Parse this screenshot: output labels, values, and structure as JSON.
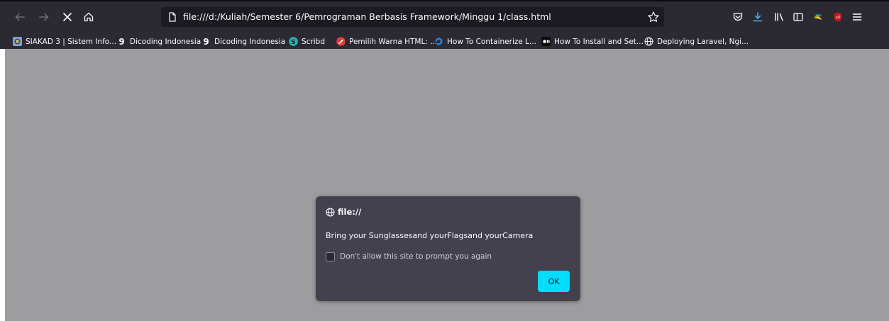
{
  "browser": {
    "url": "file:///d:/Kuliah/Semester 6/Pemrograman Berbasis Framework/Minggu 1/class.html"
  },
  "bookmarks": [
    {
      "label": "SIAKAD 3 | Sistem Info...",
      "icon": "siakad-icon"
    },
    {
      "label": "Dicoding Indonesia",
      "icon": "dicoding-icon"
    },
    {
      "label": "Dicoding Indonesia",
      "icon": "dicoding-icon"
    },
    {
      "label": "Scribd",
      "icon": "scribd-icon"
    },
    {
      "label": "Pemilih Warna HTML: ...",
      "icon": "color-picker-icon"
    },
    {
      "label": "How To Containerize L...",
      "icon": "digitalocean-icon"
    },
    {
      "label": "How To Install and Set...",
      "icon": "medium-icon"
    },
    {
      "label": "Deploying Laravel, Ngi...",
      "icon": "globe-icon"
    }
  ],
  "dialog": {
    "origin": "file://",
    "message": "Bring your Sunglassesand yourFlagsand yourCamera",
    "checkbox_label": "Don't allow this site to prompt you again",
    "checkbox_checked": false,
    "ok_label": "OK"
  },
  "colors": {
    "toolbar": "#2b2a33",
    "urlbar": "#1c1b22",
    "overlay": "#9d9d9f",
    "dialog": "#42414d",
    "accent": "#00ddff"
  }
}
